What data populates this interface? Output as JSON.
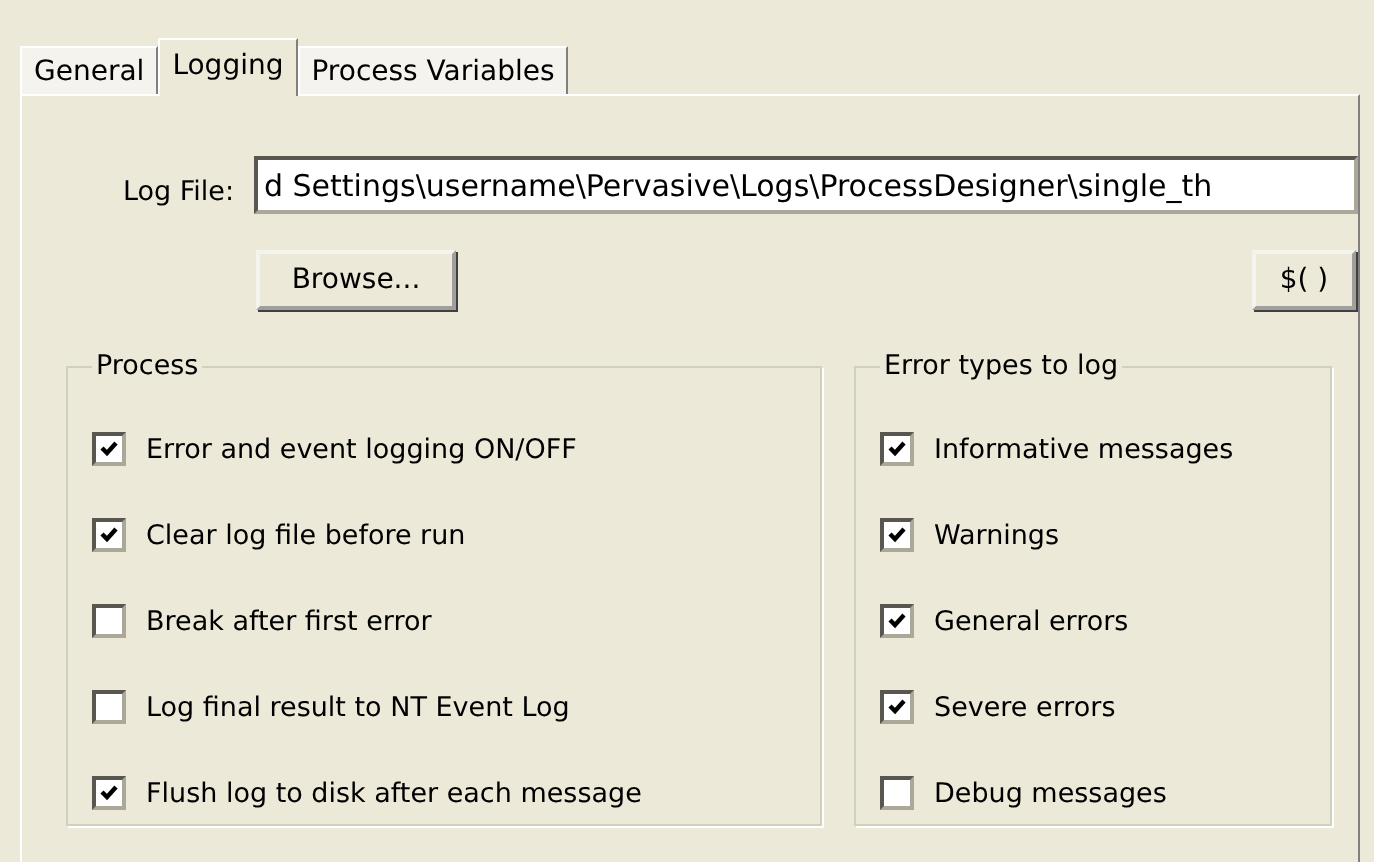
{
  "tabs": [
    {
      "label": "General",
      "selected": false
    },
    {
      "label": "Logging",
      "selected": true
    },
    {
      "label": "Process Variables",
      "selected": false
    }
  ],
  "log_file": {
    "label": "Log File:",
    "value": "d Settings\\username\\Pervasive\\Logs\\ProcessDesigner\\single_th"
  },
  "browse_button": "Browse...",
  "variable_button": "$( )",
  "process_group": {
    "title": "Process",
    "options": [
      {
        "label": "Error and event logging ON/OFF",
        "checked": true
      },
      {
        "label": "Clear log file before run",
        "checked": true
      },
      {
        "label": "Break after first error",
        "checked": false
      },
      {
        "label": "Log final result to NT Event Log",
        "checked": false
      },
      {
        "label": "Flush log to disk after each message",
        "checked": true
      }
    ]
  },
  "error_types_group": {
    "title": "Error types to log",
    "options": [
      {
        "label": "Informative messages",
        "checked": true
      },
      {
        "label": "Warnings",
        "checked": true
      },
      {
        "label": "General errors",
        "checked": true
      },
      {
        "label": "Severe errors",
        "checked": true
      },
      {
        "label": "Debug messages",
        "checked": false
      }
    ]
  }
}
